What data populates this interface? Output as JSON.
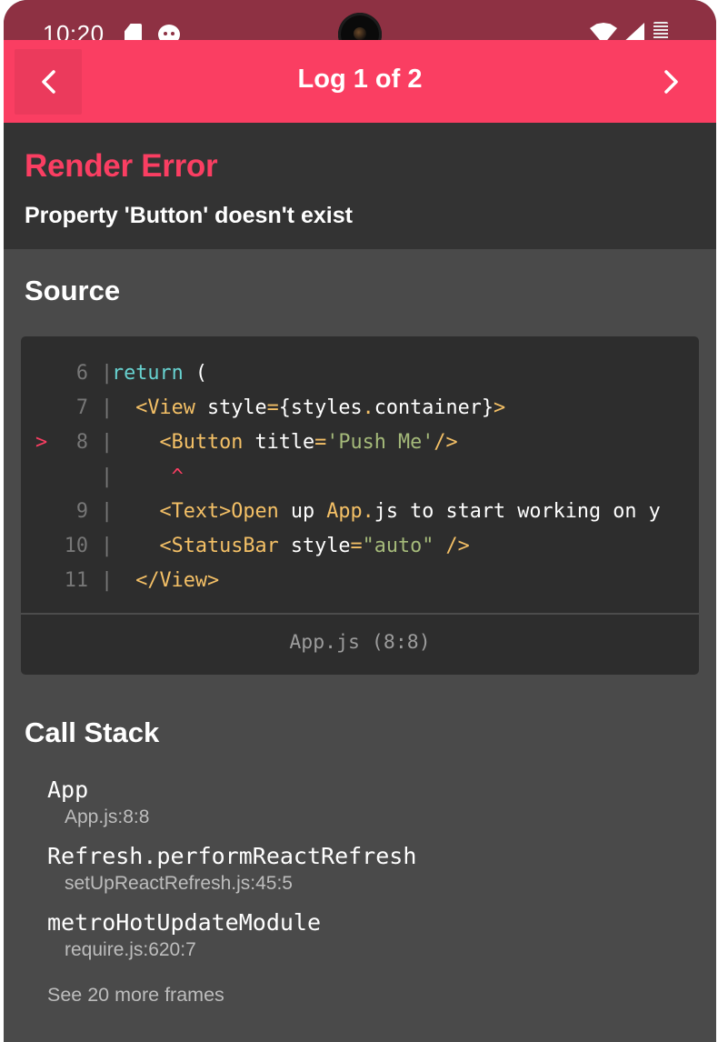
{
  "status_bar": {
    "time": "10:20",
    "icons": [
      "sd-card-icon",
      "cat-notification-icon",
      "wifi-icon",
      "cell-signal-icon",
      "battery-icon"
    ]
  },
  "header": {
    "title": "Log 1 of 2",
    "prev_icon": "chevron-left-icon",
    "next_icon": "chevron-right-icon",
    "accent_color": "#fa3e62"
  },
  "error": {
    "title": "Render Error",
    "message": "Property 'Button' doesn't exist"
  },
  "source": {
    "heading": "Source",
    "lines": [
      {
        "marker": "",
        "num": "6",
        "tokens": [
          {
            "text": "return",
            "cls": "k"
          },
          {
            "text": " (",
            "cls": "p"
          }
        ]
      },
      {
        "marker": "",
        "num": "7",
        "tokens": [
          {
            "text": "  ",
            "cls": "p"
          },
          {
            "text": "<View",
            "cls": "t"
          },
          {
            "text": " style",
            "cls": "p"
          },
          {
            "text": "=",
            "cls": "t"
          },
          {
            "text": "{styles",
            "cls": "p"
          },
          {
            "text": ".",
            "cls": "t"
          },
          {
            "text": "container}",
            "cls": "p"
          },
          {
            "text": ">",
            "cls": "t"
          }
        ]
      },
      {
        "marker": ">",
        "num": "8",
        "tokens": [
          {
            "text": "    ",
            "cls": "p"
          },
          {
            "text": "<Button",
            "cls": "t"
          },
          {
            "text": " title",
            "cls": "p"
          },
          {
            "text": "=",
            "cls": "t"
          },
          {
            "text": "'Push Me'",
            "cls": "s"
          },
          {
            "text": "/>",
            "cls": "t"
          }
        ]
      },
      {
        "marker": "",
        "num": "",
        "tokens": [
          {
            "text": "     ^",
            "cls": "caret"
          }
        ]
      },
      {
        "marker": "",
        "num": "9",
        "tokens": [
          {
            "text": "    ",
            "cls": "p"
          },
          {
            "text": "<Text>",
            "cls": "t"
          },
          {
            "text": "Open",
            "cls": "t"
          },
          {
            "text": " up ",
            "cls": "p"
          },
          {
            "text": "App.",
            "cls": "t"
          },
          {
            "text": "js to start working on y",
            "cls": "p"
          }
        ]
      },
      {
        "marker": "",
        "num": "10",
        "tokens": [
          {
            "text": "    ",
            "cls": "p"
          },
          {
            "text": "<StatusBar",
            "cls": "t"
          },
          {
            "text": " style",
            "cls": "p"
          },
          {
            "text": "=",
            "cls": "t"
          },
          {
            "text": "\"auto\"",
            "cls": "s"
          },
          {
            "text": " ",
            "cls": "p"
          },
          {
            "text": "/>",
            "cls": "t"
          }
        ]
      },
      {
        "marker": "",
        "num": "11",
        "tokens": [
          {
            "text": "  ",
            "cls": "p"
          },
          {
            "text": "</View>",
            "cls": "t"
          }
        ]
      }
    ],
    "location": "App.js (8:8)"
  },
  "call_stack": {
    "heading": "Call Stack",
    "frames": [
      {
        "name": "App",
        "location": "App.js:8:8"
      },
      {
        "name": "Refresh.performReactRefresh",
        "location": "setUpReactRefresh.js:45:5"
      },
      {
        "name": "metroHotUpdateModule",
        "location": "require.js:620:7"
      }
    ],
    "more": "See 20 more frames"
  }
}
